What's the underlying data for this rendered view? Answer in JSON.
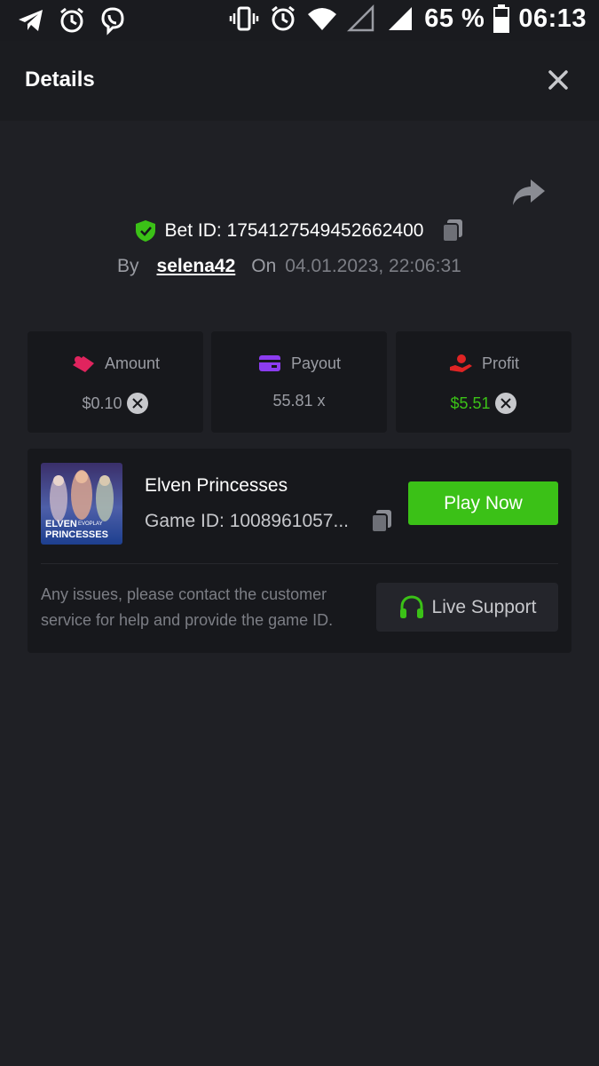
{
  "status_bar": {
    "left_icons": [
      "telegram-icon",
      "alarm-icon",
      "viber-icon"
    ],
    "right_icons": [
      "vibrate-icon",
      "alarm-icon",
      "wifi-icon",
      "signal-icon",
      "battery-icon"
    ],
    "battery": "65 %",
    "time": "06:13"
  },
  "header": {
    "title": "Details",
    "close_icon": "close-icon"
  },
  "bet": {
    "id_text": "Bet ID: 1754127549452662400",
    "by_label": "By",
    "username": "selena42",
    "on_label": "On",
    "date": "04.01.2023, 22:06:31"
  },
  "stats": [
    {
      "label": "Amount",
      "value": "$0.10",
      "icon": "amount-icon",
      "color": "#e0245e"
    },
    {
      "label": "Payout",
      "value": "55.81 x",
      "icon": "wallet-icon",
      "color": "#8c3cf0"
    },
    {
      "label": "Profit",
      "value": "$5.51",
      "icon": "profit-icon",
      "color": "#e02424"
    }
  ],
  "game": {
    "name": "Elven Princesses",
    "id_text": "Game ID: 1008961057...",
    "play_label": "Play Now",
    "thumb_title_line1": "ELVEN",
    "thumb_title_line2": "PRINCESSES",
    "thumb_brand": "EVOPLAY"
  },
  "support": {
    "text": "Any issues, please contact the customer service for help and provide the game ID.",
    "button_label": "Live Support"
  },
  "colors": {
    "accent_green": "#3bc117",
    "profit_green": "#3bc117",
    "background": "#1f2025",
    "card": "#17181c"
  }
}
